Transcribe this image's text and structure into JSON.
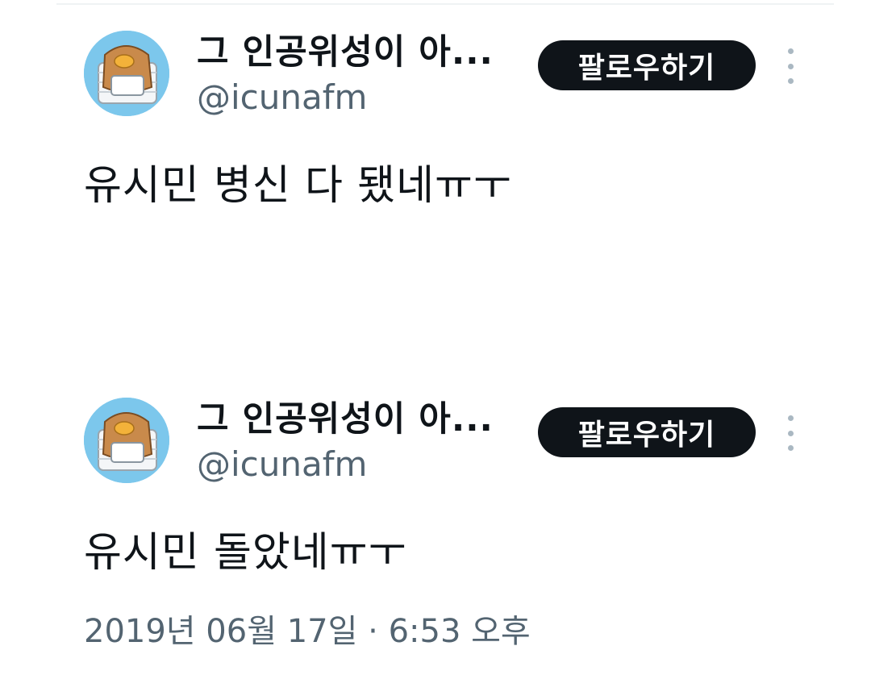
{
  "tweets": [
    {
      "display_name": "그 인공위성이 아...",
      "handle": "@icunafm",
      "follow_label": "팔로우하기",
      "text": "유시민 병신 다 됐네ㅠㅜ"
    },
    {
      "display_name": "그 인공위성이 아...",
      "handle": "@icunafm",
      "follow_label": "팔로우하기",
      "text": "유시민 돌았네ㅠㅜ"
    }
  ],
  "timestamp": "2019년 06월 17일 · 6:53 오후",
  "colors": {
    "text_primary": "#0f1419",
    "text_secondary": "#536471",
    "button_bg": "#0f1419",
    "button_text": "#ffffff",
    "avatar_bg": "#7cc7ec"
  },
  "icons": {
    "avatar": "toast-bread-avatar-icon",
    "more": "more-vertical-icon"
  }
}
